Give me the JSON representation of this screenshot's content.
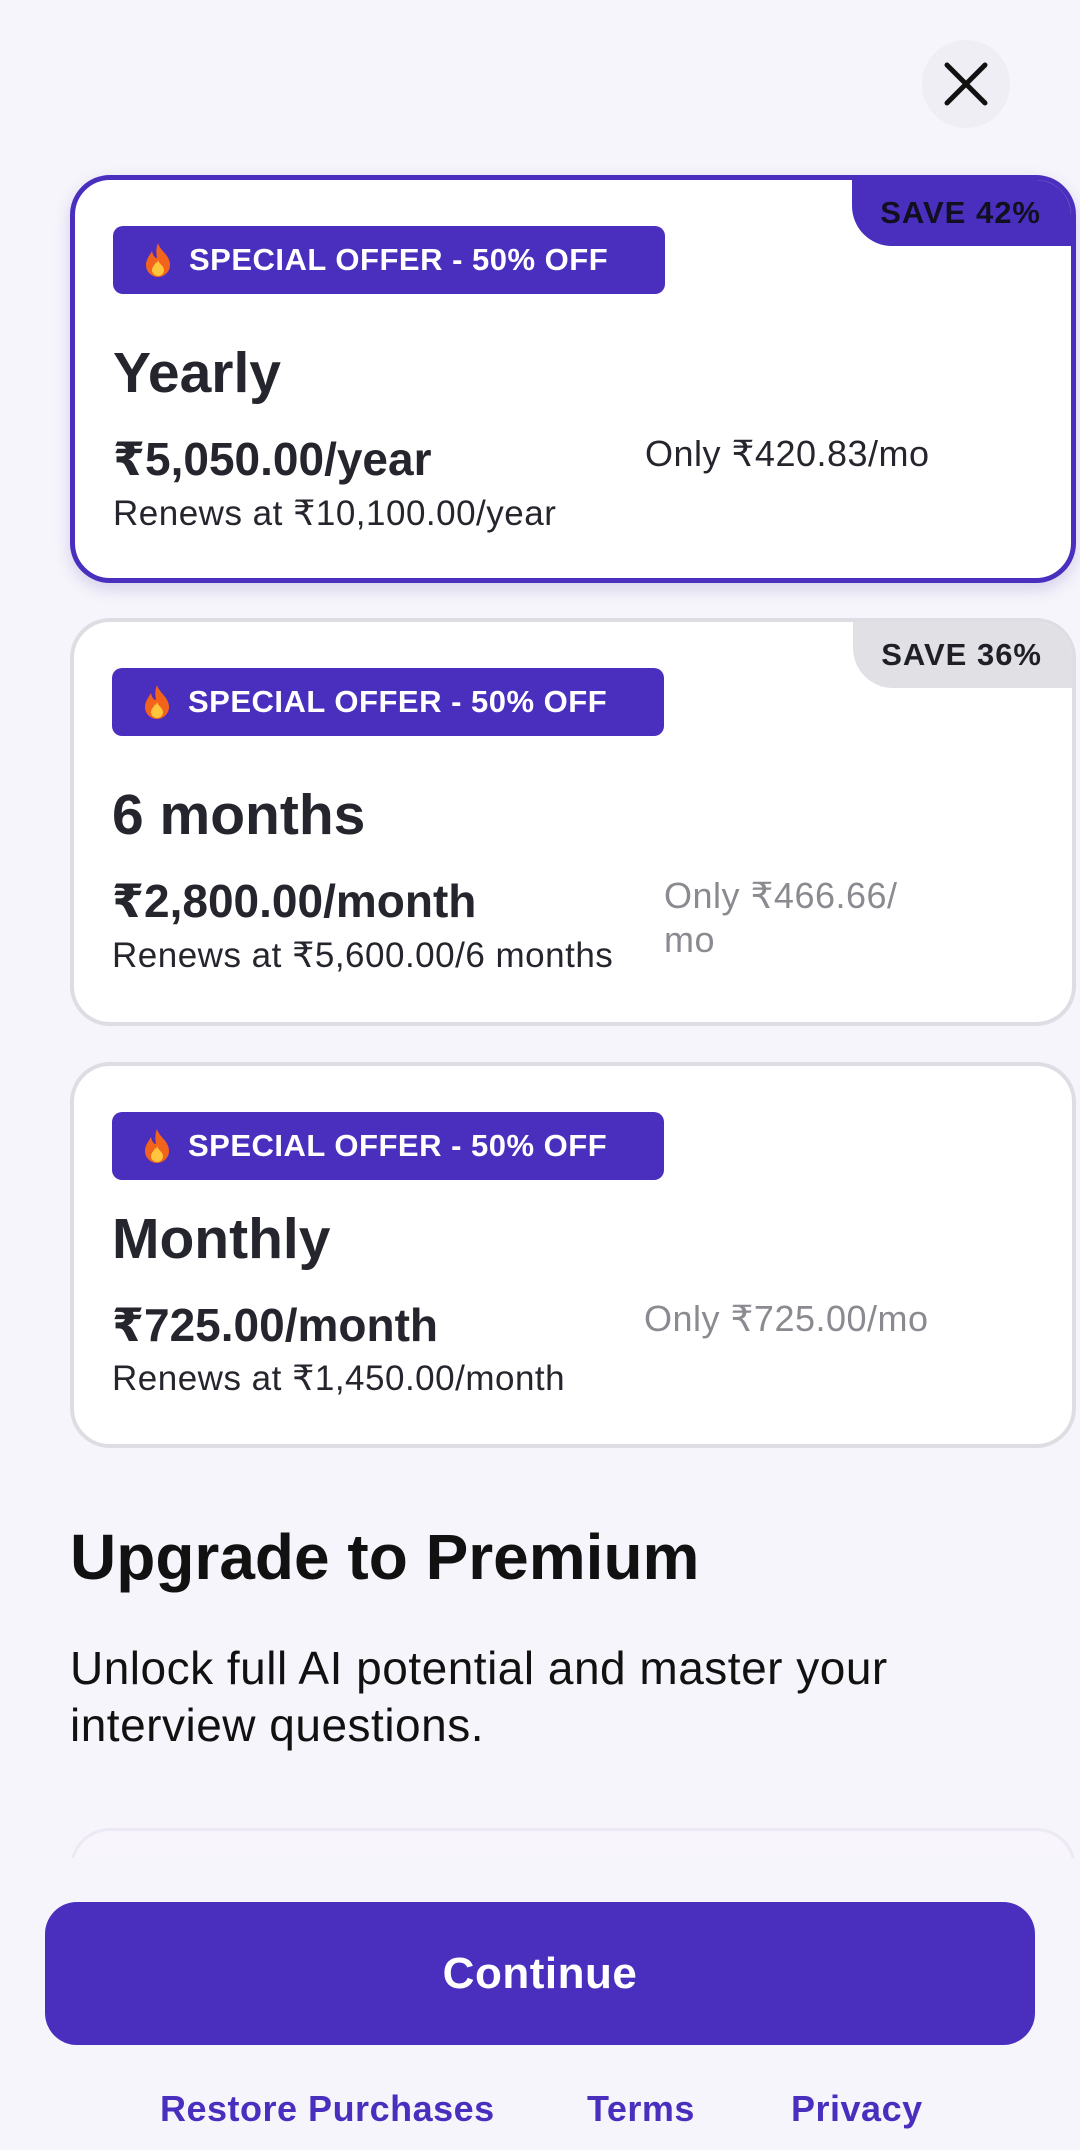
{
  "plans": [
    {
      "save_badge": "SAVE 42%",
      "offer_label": "SPECIAL OFFER - 50% OFF",
      "name": "Yearly",
      "price": "₹5,050.00/year",
      "renews": "Renews at ₹10,100.00/year",
      "per_month": "Only ₹420.83/mo",
      "selected": true
    },
    {
      "save_badge": "SAVE 36%",
      "offer_label": "SPECIAL OFFER - 50% OFF",
      "name": "6 months",
      "price": "₹2,800.00/month",
      "renews": "Renews at ₹5,600.00/6 months",
      "per_month_line1": "Only ₹466.66/",
      "per_month_line2": "mo",
      "selected": false
    },
    {
      "offer_label": "SPECIAL OFFER - 50% OFF",
      "name": "Monthly",
      "price": "₹725.00/month",
      "renews": "Renews at ₹1,450.00/month",
      "per_month": "Only ₹725.00/mo",
      "selected": false
    }
  ],
  "heading": "Upgrade to Premium",
  "subheading": "Unlock full AI potential and master your interview questions.",
  "continue_label": "Continue",
  "footer_links": [
    "Restore Purchases",
    "Terms",
    "Privacy"
  ],
  "icons": {
    "close": "close-icon",
    "offer": "flame-icon"
  },
  "colors": {
    "accent": "#4a2fbf",
    "background": "#f6f5fb",
    "muted_text": "#8a8a90"
  }
}
